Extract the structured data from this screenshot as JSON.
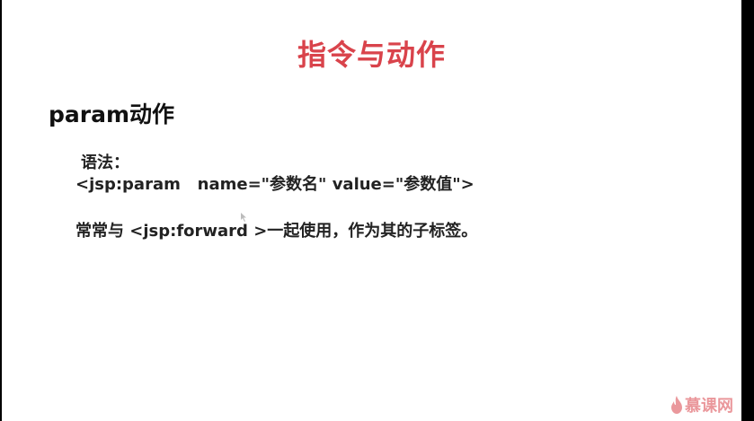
{
  "slide": {
    "title": "指令与动作",
    "section_heading": "param动作",
    "syntax_label": "语法：",
    "syntax_code": "<jsp:param   name=\"参数名\" value=\"参数值\">",
    "usage_text": "常常与 <jsp:forward >一起使用，作为其的子标签。"
  },
  "watermark": {
    "brand_text": "慕课网",
    "icon": "flame-icon"
  },
  "colors": {
    "title_red": "#d9434b",
    "text": "#222222",
    "background": "#ffffff"
  }
}
